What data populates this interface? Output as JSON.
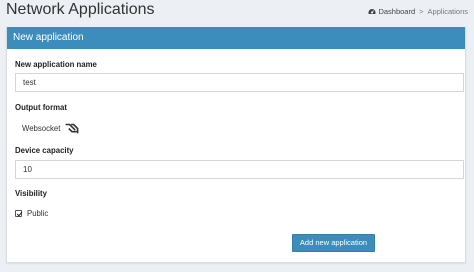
{
  "header": {
    "title": "Network Applications",
    "breadcrumb": {
      "home_icon": "dashboard-icon",
      "home_label": "Dashboard",
      "separator": ">",
      "current": "Applications"
    }
  },
  "form": {
    "box_title": "New application",
    "name": {
      "label": "New application name",
      "value": "test"
    },
    "output_format": {
      "label": "Output format",
      "value": "Websocket",
      "icon": "websocket-icon"
    },
    "device_capacity": {
      "label": "Device capacity",
      "value": "10"
    },
    "visibility": {
      "label": "Visibility",
      "option_label": "Public",
      "checked": true
    },
    "submit_label": "Add new application"
  },
  "colors": {
    "accent": "#3c8dbc",
    "background": "#ecf0f5"
  }
}
